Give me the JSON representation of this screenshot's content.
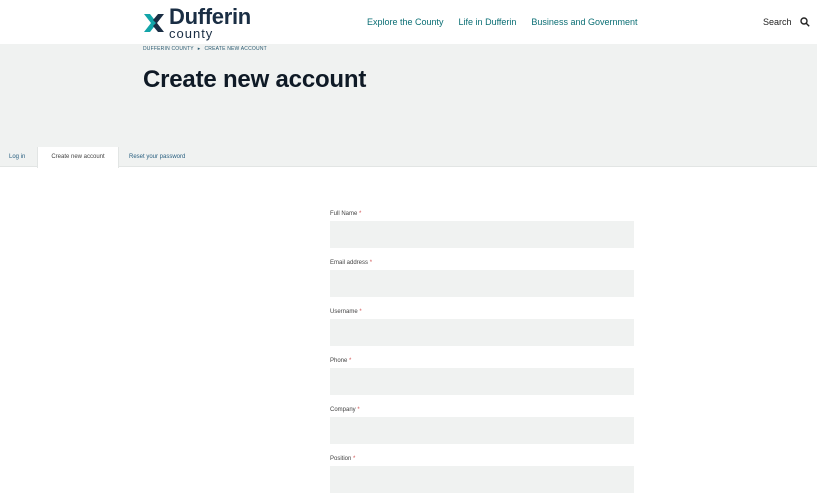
{
  "header": {
    "logo_name": "Dufferin",
    "logo_sub": "county",
    "nav": [
      "Explore the County",
      "Life in Dufferin",
      "Business and Government"
    ],
    "search_label": "Search"
  },
  "hero": {
    "breadcrumb": [
      "DUFFERIN COUNTY",
      "CREATE NEW ACCOUNT"
    ],
    "breadcrumb_separator": "▸",
    "title": "Create new account"
  },
  "tabs": [
    "Log in",
    "Create new account",
    "Reset your password"
  ],
  "form": {
    "required_marker": "*",
    "fields": [
      {
        "label": "Full Name",
        "value": ""
      },
      {
        "label": "Email address",
        "value": ""
      },
      {
        "label": "Username",
        "value": ""
      },
      {
        "label": "Phone",
        "value": ""
      },
      {
        "label": "Company",
        "value": ""
      },
      {
        "label": "Position",
        "value": ""
      }
    ]
  },
  "colors": {
    "brand_dark": "#1a2e44",
    "nav_link": "#0a6e74",
    "hero_bg": "#f0f2f1",
    "required": "#d05050"
  },
  "icons": {
    "logo": "dufferin-logo-mark",
    "search": "search-icon"
  }
}
